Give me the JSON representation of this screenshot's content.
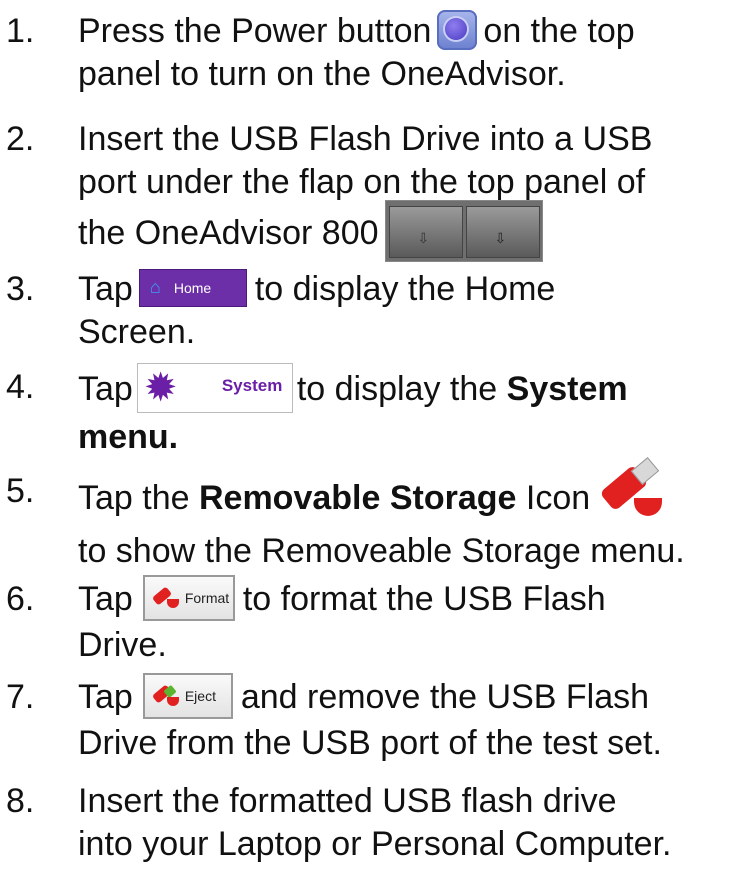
{
  "steps": [
    {
      "num": "1.",
      "l1a": "Press the Power button",
      "l1b": "on the top",
      "l2": "panel to turn on the OneAdvisor."
    },
    {
      "num": "2.",
      "l1": "Insert the USB Flash Drive into a USB",
      "l2": "port under the flap on the top panel of",
      "l3": "the OneAdvisor 800"
    },
    {
      "num": "3.",
      "l1a": "Tap",
      "btn": "Home",
      "l1b": "to display the Home",
      "l2": "Screen."
    },
    {
      "num": "4.",
      "l1a": "Tap",
      "btn": "System",
      "l1b": "to display the",
      "l1bold": "System",
      "l2bold": "menu."
    },
    {
      "num": "5.",
      "l1a": "Tap the",
      "l1bold": "Removable Storage",
      "l1b": "Icon",
      "l2": "to show the Removeable Storage menu."
    },
    {
      "num": "6.",
      "l1a": "Tap",
      "btn": "Format",
      "l1b": "to format the USB Flash",
      "l2": "Drive."
    },
    {
      "num": "7.",
      "l1a": "Tap",
      "btn": "Eject",
      "l1b": "and remove the USB Flash",
      "l2": "Drive from the USB port of the test set."
    },
    {
      "num": "8.",
      "l1": "Insert the formatted USB flash drive",
      "l2": "into your Laptop or Personal Computer."
    }
  ],
  "icons": {
    "power": "power-icon",
    "usb_ports": "usb-ports-image",
    "home": "home-icon",
    "gear": "gear-icon",
    "storage": "usb-drive-icon",
    "format": "usb-format-icon",
    "eject": "usb-eject-icon"
  },
  "colors": {
    "home_button": "#6d2fa8",
    "system_accent": "#6a1fa6",
    "usb_red": "#e12020"
  }
}
